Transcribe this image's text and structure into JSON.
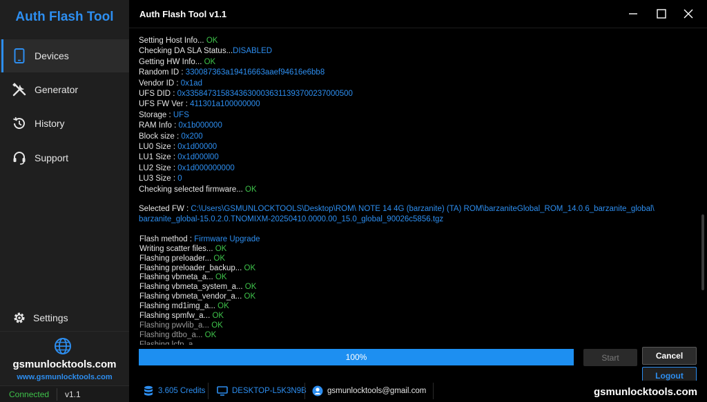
{
  "app_title": "Auth Flash Tool",
  "window_title": "Auth Flash Tool  v1.1",
  "nav": [
    {
      "label": "Devices",
      "icon": "phone-icon",
      "active": true
    },
    {
      "label": "Generator",
      "icon": "tools-icon",
      "active": false
    },
    {
      "label": "History",
      "icon": "history-icon",
      "active": false
    },
    {
      "label": "Support",
      "icon": "headset-icon",
      "active": false
    }
  ],
  "settings_label": "Settings",
  "brand": {
    "name": "gsmunlocktools.com",
    "url": "www.gsmunlocktools.com"
  },
  "connection_status": "Connected",
  "version": "v1.1",
  "log": [
    {
      "label": "Setting Host Info... ",
      "value": "OK",
      "color": "green"
    },
    {
      "label": "Checking DA SLA Status...",
      "value": "DISABLED",
      "color": "blue"
    },
    {
      "label": "Getting HW Info... ",
      "value": "OK",
      "color": "green"
    },
    {
      "label": "Random ID : ",
      "value": "330087363a19416663aaef94616e6bb8",
      "color": "blue"
    },
    {
      "label": "Vendor ID : ",
      "value": "0x1ad",
      "color": "blue"
    },
    {
      "label": "UFS DID : ",
      "value": "0x33584731583436300036311393700237000500",
      "color": "blue"
    },
    {
      "label": "UFS FW Ver : ",
      "value": "411301a100000000",
      "color": "blue"
    },
    {
      "label": "Storage : ",
      "value": "UFS",
      "color": "blue"
    },
    {
      "label": "RAM Info : ",
      "value": "0x1b000000",
      "color": "blue"
    },
    {
      "label": "Block size : ",
      "value": "0x200",
      "color": "blue"
    },
    {
      "label": "LU0 Size : ",
      "value": "0x1d00000",
      "color": "blue"
    },
    {
      "label": "LU1 Size : ",
      "value": "0x1d000l00",
      "color": "blue"
    },
    {
      "label": "LU2 Size : ",
      "value": "0x1d000000000",
      "color": "blue"
    },
    {
      "label": "LU3 Size : ",
      "value": "0",
      "color": "blue"
    },
    {
      "label": "Checking selected firmware... ",
      "value": "OK",
      "color": "green"
    },
    {
      "label": "Selected FW : ",
      "value": "C:\\Users\\GSMUNLOCKTOOLS\\Desktop\\ROM\\ NOTE 14 4G (barzanite) (TA) ROM\\barzaniteGlobal_ROM_14.0.6_barzanite_global\\",
      "color": "blue"
    },
    {
      "label": "",
      "value": "barzanite_global-15.0.2.0.TNOMIXM-20250410.0000.00_15.0_global_90026c5856.tgz",
      "color": "blue"
    },
    {
      "label": "Flash method : ",
      "value": "Firmware Upgrade",
      "color": "blue"
    },
    {
      "label": "Writing scatter files... ",
      "value": "OK",
      "color": "green"
    },
    {
      "label": "Flashing preloader... ",
      "value": "OK",
      "color": "green"
    },
    {
      "label": "Flashing preloader_backup... ",
      "value": "OK",
      "color": "green"
    },
    {
      "label": "Flashing vbmeta_a... ",
      "value": "OK",
      "color": "green"
    },
    {
      "label": "Flashing vbmeta_system_a... ",
      "value": "OK",
      "color": "green"
    },
    {
      "label": "Flashing vbmeta_vendor_a... ",
      "value": "OK",
      "color": "green"
    },
    {
      "label": "Flashing md1img_a... ",
      "value": "OK",
      "color": "green"
    },
    {
      "label": "Flashing spmfw_a... ",
      "value": "OK",
      "color": "green"
    },
    {
      "label": "Flashing pwvlib_a... ",
      "value": "OK",
      "color": "green"
    },
    {
      "label": "Flashing dtbo_a... ",
      "value": "OK",
      "color": "green"
    },
    {
      "label": "Flashing lcfp_a...",
      "value": "",
      "color": "green"
    }
  ],
  "progress": {
    "percent_text": "100%",
    "fraction": 1.0
  },
  "buttons": {
    "start": "Start",
    "cancel": "Cancel",
    "logout": "Logout"
  },
  "status": {
    "credits": "3.605 Credits",
    "computer": "DESKTOP-L5K3N9B",
    "email": "gsmunlocktools@gmail.com"
  },
  "footer_brand": "gsmunlocktools.com",
  "colors": {
    "accent": "#2d8ef0",
    "ok": "#3ec24a"
  }
}
